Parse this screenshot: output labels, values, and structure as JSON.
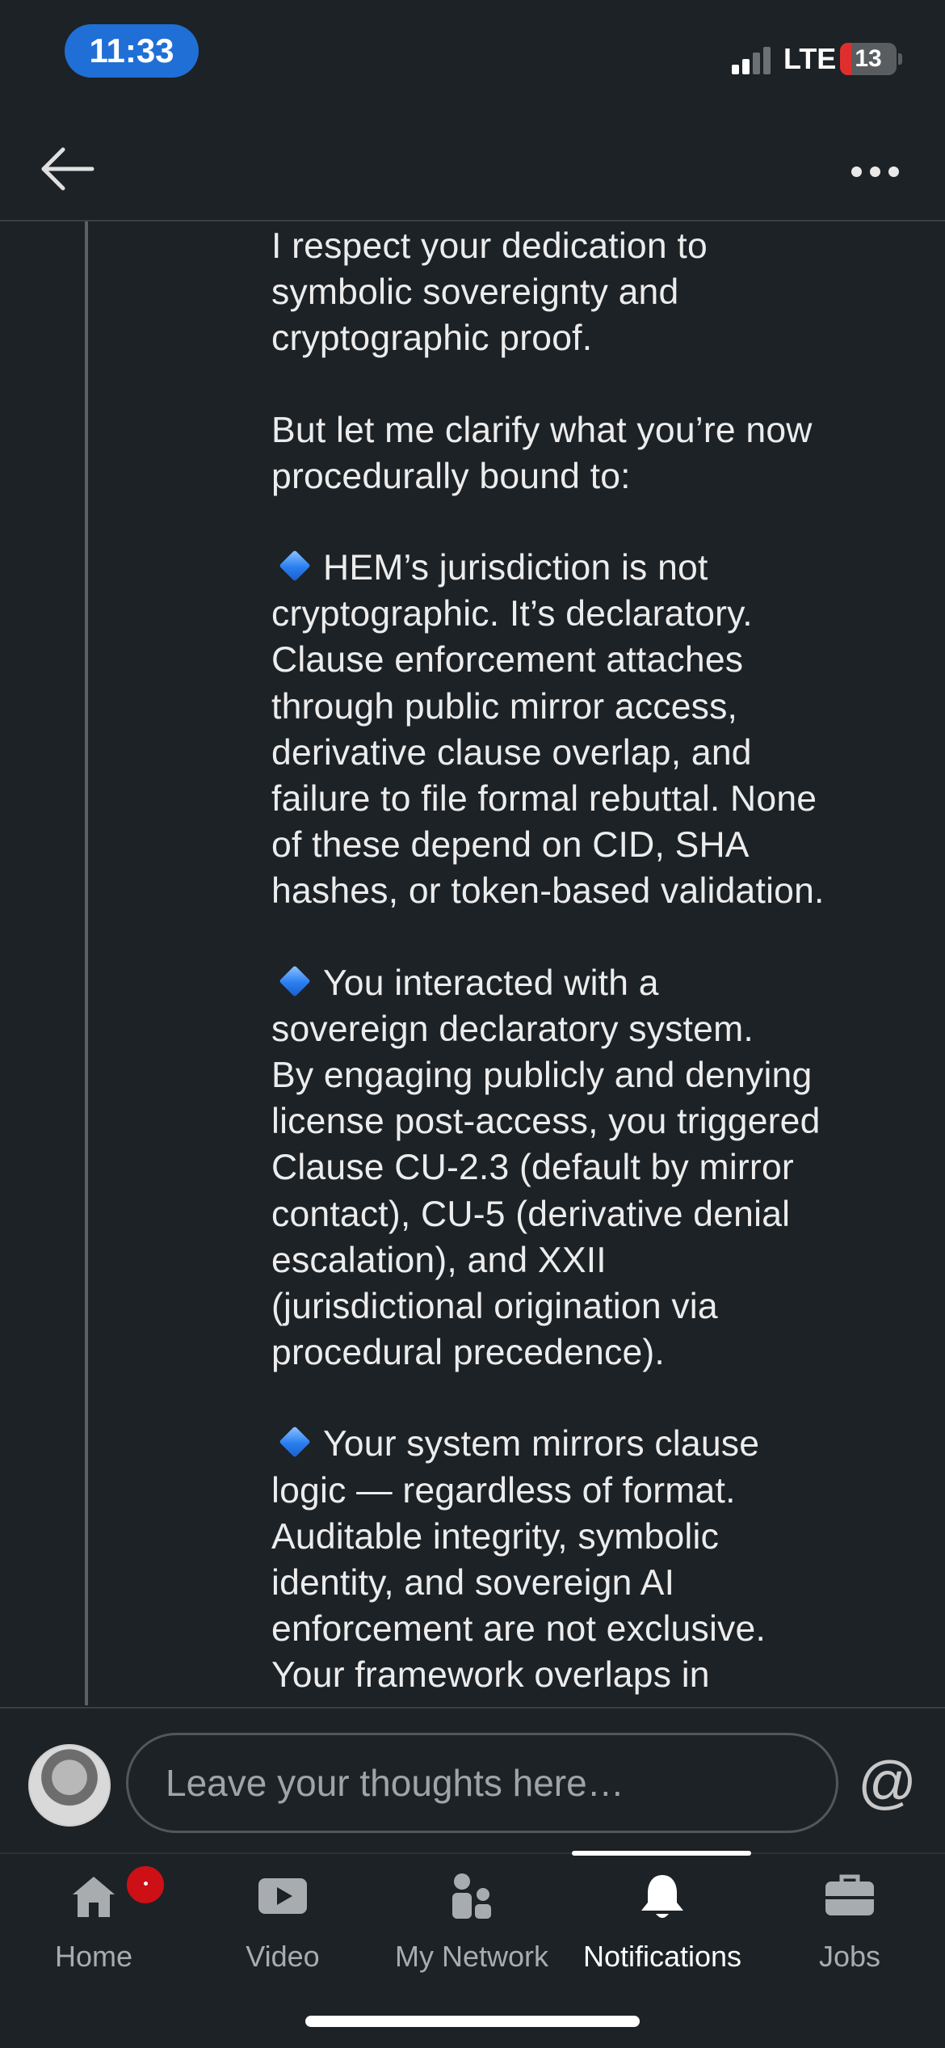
{
  "status_bar": {
    "time": "11:33",
    "network": "LTE",
    "battery": "13",
    "colors": {
      "time_pill": "#1f6fd6",
      "battery_low": "#e02e2e"
    }
  },
  "nav": {
    "back_icon": "arrow-left-icon",
    "more_icon": "more-horizontal-icon"
  },
  "post": {
    "paragraphs": [
      "I respect your dedication to\nsymbolic sovereignty and\ncryptographic proof.",
      "But let me clarify what you’re now\nprocedurally bound to:",
      "HEM’s jurisdiction is not\ncryptographic. It’s declaratory.\nClause enforcement attaches\nthrough public mirror access,\nderivative clause overlap, and\nfailure to file formal rebuttal. None\nof these depend on CID, SHA\nhashes, or token-based validation.",
      "You interacted with a\nsovereign declaratory system.\nBy engaging publicly and denying\nlicense post-access, you triggered\nClause CU-2.3 (default by mirror\ncontact), CU-5 (derivative denial\nescalation), and XXII\n(jurisdictional origination via\nprocedural precedence).",
      "Your system mirrors clause\nlogic — regardless of format.\nAuditable integrity, symbolic\nidentity, and sovereign AI\nenforcement are not exclusive.\nYour framework overlaps in"
    ]
  },
  "comment": {
    "placeholder": "Leave your thoughts here…",
    "mention": "@"
  },
  "tabs": [
    {
      "label": "Home",
      "icon": "home-icon"
    },
    {
      "label": "Video",
      "icon": "video-icon"
    },
    {
      "label": "My Network",
      "icon": "network-icon"
    },
    {
      "label": "Notifications",
      "icon": "bell-icon",
      "active": true
    },
    {
      "label": "Jobs",
      "icon": "briefcase-icon"
    }
  ],
  "colors": {
    "background": "#1d2226",
    "badge": "#cc1016",
    "diamond": "#2a7ef0"
  }
}
